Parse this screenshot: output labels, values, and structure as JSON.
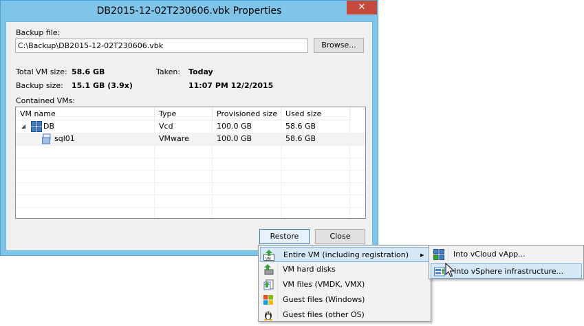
{
  "window": {
    "title": "DB2015-12-02T230606.vbk Properties",
    "close_glyph": "✕"
  },
  "backup_file": {
    "label": "Backup file:",
    "value": "C:\\Backup\\DB2015-12-02T230606.vbk",
    "browse_label": "Browse..."
  },
  "stats": {
    "total_vm_size_label": "Total VM size:",
    "total_vm_size_value": "58.6 GB",
    "backup_size_label": "Backup size:",
    "backup_size_value": "15.1 GB (3.9x)",
    "taken_label": "Taken:",
    "taken_day": "Today",
    "taken_time": "11:07 PM 12/2/2015"
  },
  "contained_vms": {
    "label": "Contained VMs:",
    "columns": [
      "VM name",
      "Type",
      "Provisioned size",
      "Used size"
    ],
    "rows": [
      {
        "name": "DB",
        "type": "Vcd",
        "provisioned": "100.0 GB",
        "used": "58.6 GB",
        "icon": "vapp-icon",
        "expander": "◢"
      },
      {
        "name": "sql01",
        "type": "VMware",
        "provisioned": "100.0 GB",
        "used": "58.6 GB",
        "icon": "vm-icon"
      }
    ]
  },
  "buttons": {
    "restore": "Restore",
    "close": "Close"
  },
  "restore_menu": {
    "items": [
      {
        "label": "Entire VM (including registration)",
        "icon": "entire-vm-icon",
        "has_submenu": true,
        "arrow": "▶"
      },
      {
        "label": "VM hard disks",
        "icon": "hard-disk-icon"
      },
      {
        "label": "VM files (VMDK, VMX)",
        "icon": "vm-files-icon"
      },
      {
        "label": "Guest files (Windows)",
        "icon": "windows-icon"
      },
      {
        "label": "Guest files (other OS)",
        "icon": "linux-icon"
      }
    ]
  },
  "submenu": {
    "items": [
      {
        "label": "Into vCloud vApp...",
        "icon": "vcloud-icon"
      },
      {
        "label": "Into vSphere infrastructure...",
        "icon": "vsphere-icon"
      }
    ]
  },
  "colors": {
    "window_frame": "#7fc5ea",
    "close_button": "#c7493c",
    "highlight": "#d5e8f7"
  }
}
